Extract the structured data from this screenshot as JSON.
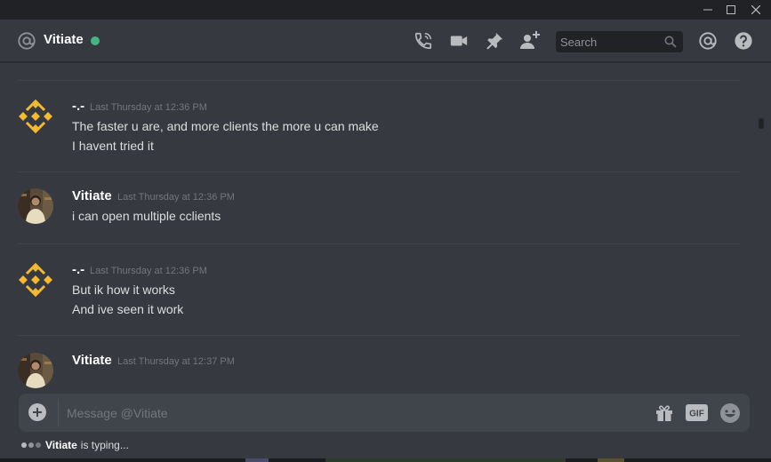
{
  "window": {
    "minimize_icon": "minimize-icon",
    "maximize_icon": "maximize-icon",
    "close_icon": "close-icon"
  },
  "header": {
    "channel_icon": "at-icon",
    "channel_name": "Vitiate",
    "status": "online",
    "status_color": "#43b581",
    "toolbar_icons": [
      "call-icon",
      "video-icon",
      "pin-icon",
      "add-user-icon",
      "mention-icon",
      "help-icon"
    ],
    "search_placeholder": "Search"
  },
  "messages": [
    {
      "author": "-.-",
      "author_color": "#ffffff",
      "avatar": "binance-logo",
      "timestamp": "Last Thursday at 12:36 PM",
      "lines": [
        "The faster u are, and more clients the more u can make",
        "I havent tried it"
      ]
    },
    {
      "author": "Vitiate",
      "author_color": "#ffffff",
      "avatar": "user-photo",
      "timestamp": "Last Thursday at 12:36 PM",
      "lines": [
        "i can open multiple cclients"
      ]
    },
    {
      "author": "-.-",
      "author_color": "#ffffff",
      "avatar": "binance-logo",
      "timestamp": "Last Thursday at 12:36 PM",
      "lines": [
        "But ik how it works",
        "And ive seen it work"
      ]
    },
    {
      "author": "Vitiate",
      "author_color": "#ffffff",
      "avatar": "user-photo",
      "timestamp": "Last Thursday at 12:37 PM",
      "lines": []
    }
  ],
  "composer": {
    "placeholder": "Message @Vitiate",
    "value": "",
    "icons": [
      "plus-icon",
      "gift-icon",
      "gif-icon",
      "emoji-icon"
    ],
    "gif_label": "GIF"
  },
  "typing_indicator": {
    "user": "Vitiate",
    "text": "is typing..."
  },
  "colors": {
    "background": "#36393f",
    "titlebar": "#202225",
    "accent_gold": "#f3ba2f",
    "online": "#43b581"
  }
}
